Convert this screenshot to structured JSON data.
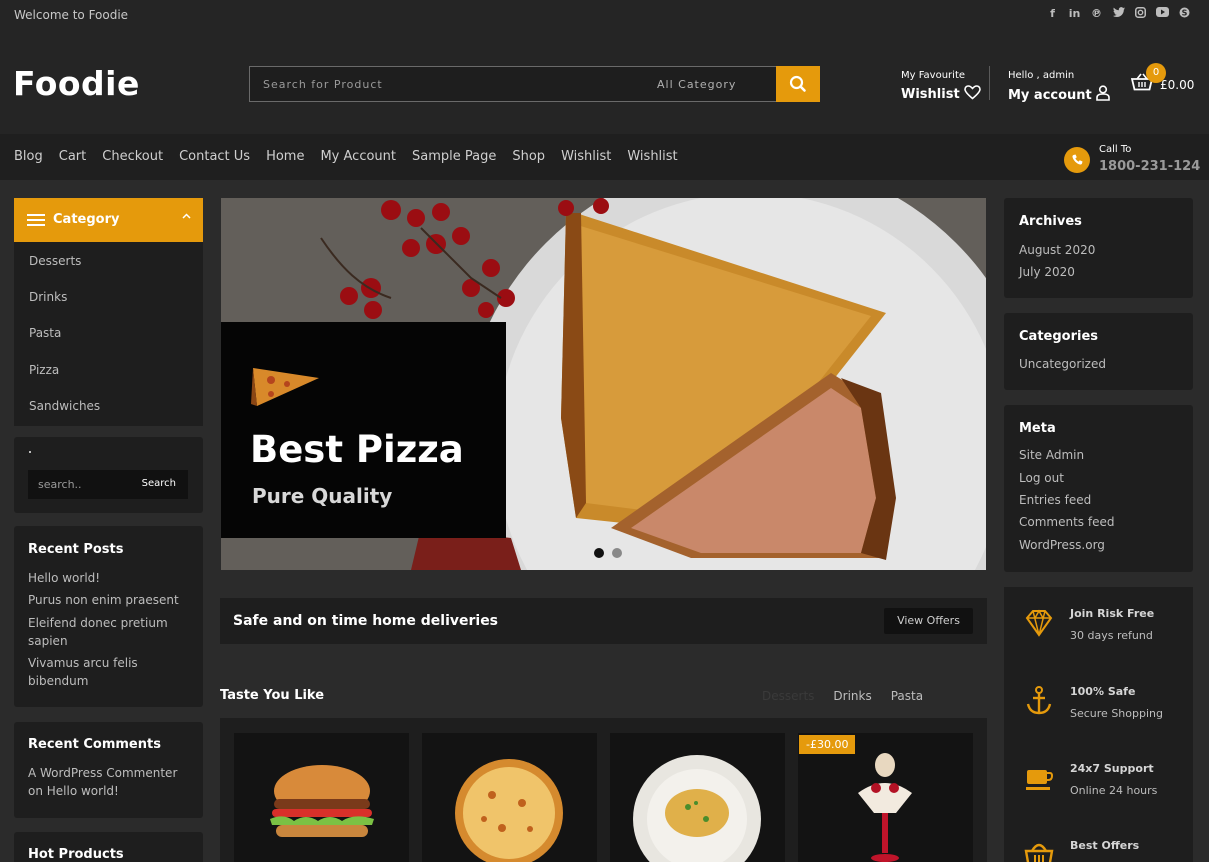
{
  "topbar": {
    "welcome": "Welcome to Foodie",
    "social_icons": [
      "facebook-icon",
      "linkedin-icon",
      "pinterest-icon",
      "twitter-icon",
      "instagram-icon",
      "youtube-icon",
      "skype-icon"
    ]
  },
  "header": {
    "logo": "Foodie",
    "search_placeholder": "Search for Product",
    "category_select": "All Category",
    "wishlist_small": "My Favourite",
    "wishlist_big": "Wishlist",
    "account_small": "Hello , admin",
    "account_big": "My account",
    "cart_count": "0",
    "cart_total": "£0.00"
  },
  "nav": {
    "items": [
      "Blog",
      "Cart",
      "Checkout",
      "Contact Us",
      "Home",
      "My Account",
      "Sample Page",
      "Shop",
      "Wishlist",
      "Wishlist"
    ],
    "call_label": "Call To",
    "call_number": "1800-231-124"
  },
  "left": {
    "category_title": "Category",
    "categories": [
      "Desserts",
      "Drinks",
      "Pasta",
      "Pizza",
      "Sandwiches"
    ],
    "search_placeholder": "search..",
    "search_button": "Search",
    "recent_posts_title": "Recent Posts",
    "recent_posts": [
      "Hello world!",
      "Purus non enim praesent",
      "Eleifend donec pretium",
      "sapien",
      "Vivamus arcu felis",
      "bibendum"
    ],
    "recent_comments_title": "Recent Comments",
    "recent_comments": [
      "A WordPress Commenter",
      "on Hello world!"
    ],
    "hot_products_title": "Hot Products"
  },
  "hero": {
    "title": "Best Pizza",
    "subtitle": "Pure Quality"
  },
  "delivery": {
    "text": "Safe and on time home deliveries",
    "button": "View Offers"
  },
  "taste": {
    "title": "Taste You Like",
    "tabs": [
      "Desserts",
      "Drinks",
      "Pasta"
    ],
    "sale_badge": "-£30.00"
  },
  "right": {
    "archives_title": "Archives",
    "archives": [
      "August 2020",
      "July 2020"
    ],
    "categories_title": "Categories",
    "categories": [
      "Uncategorized"
    ],
    "meta_title": "Meta",
    "meta": [
      "Site Admin",
      "Log out",
      "Entries feed",
      "Comments feed",
      "WordPress.org"
    ],
    "features": [
      {
        "title": "Join Risk Free",
        "sub": "30 days refund",
        "icon": "diamond-icon"
      },
      {
        "title": "100% Safe",
        "sub": "Secure Shopping",
        "icon": "anchor-icon"
      },
      {
        "title": "24x7 Support",
        "sub": "Online 24 hours",
        "icon": "coffee-cup-icon"
      },
      {
        "title": "Best Offers",
        "sub": "",
        "icon": "basket-icon"
      }
    ]
  },
  "colors": {
    "accent": "#e59a0c",
    "background": "#2b2b2b",
    "panel": "#1e1e1e"
  }
}
